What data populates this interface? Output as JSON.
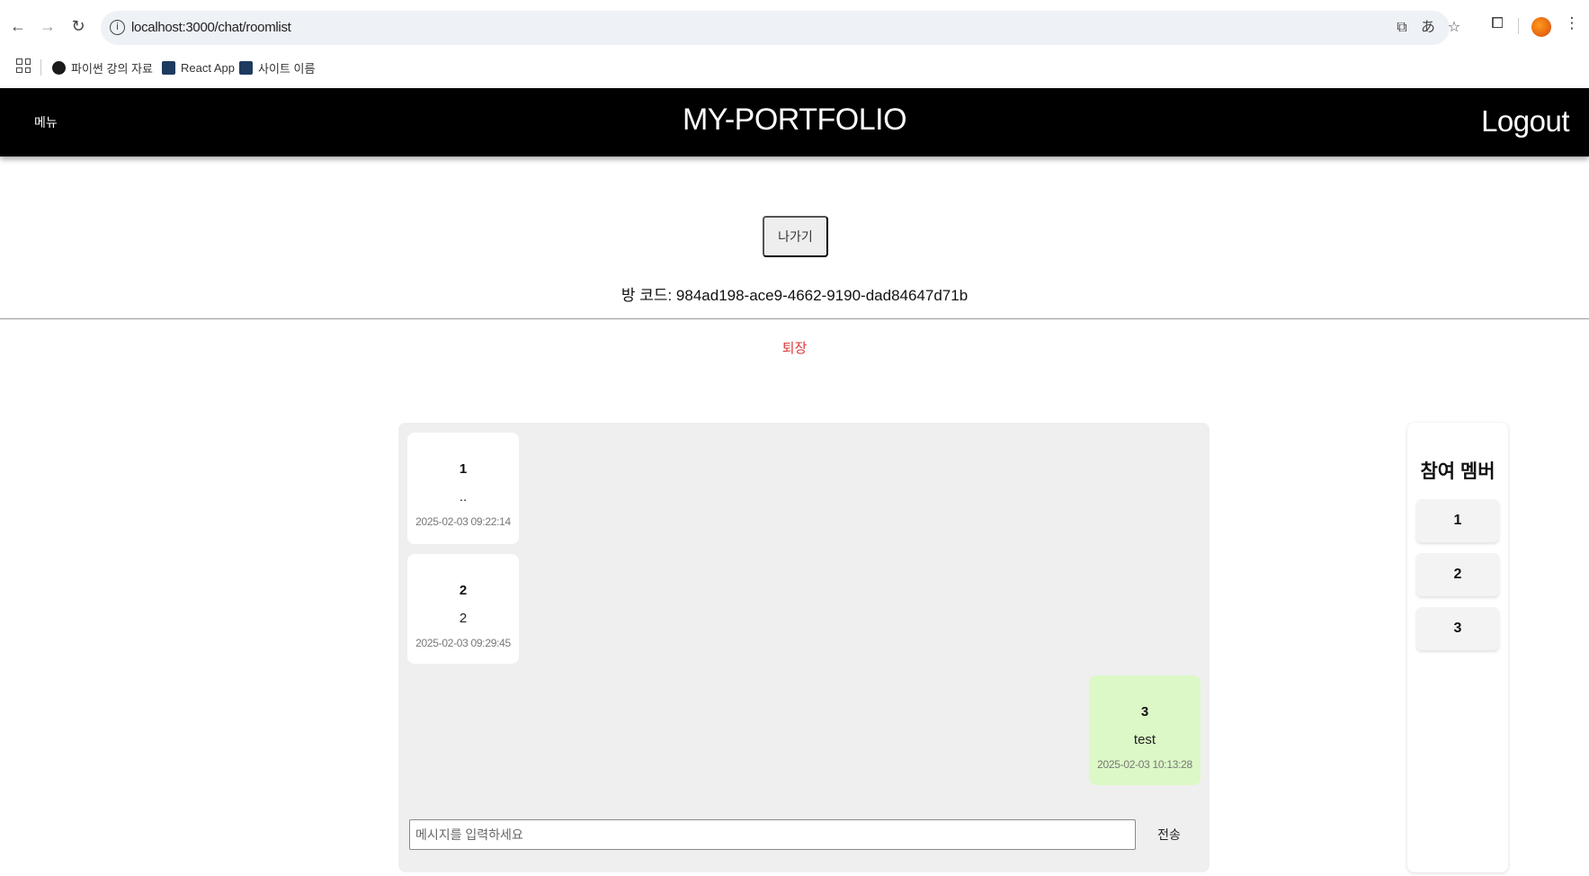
{
  "browser": {
    "url": "localhost:3000/chat/roomlist",
    "bookmarks": [
      {
        "label": "파이썬 강의 자료",
        "icon": "github-icon"
      },
      {
        "label": "React App",
        "icon": "react-icon"
      },
      {
        "label": "사이트 이름",
        "icon": "react-icon"
      }
    ]
  },
  "header": {
    "menu_label": "메뉴",
    "brand": "MY-PORTFOLIO",
    "logout_label": "Logout"
  },
  "room": {
    "exit_button_label": "나가기",
    "room_code_text": "방 코드: 984ad198-ace9-4662-9190-dad84647d71b",
    "leave_link_label": "퇴장"
  },
  "chat": {
    "messages": [
      {
        "sender": "1",
        "content": "..",
        "time": "2025-02-03 09:22:14",
        "mine": false
      },
      {
        "sender": "2",
        "content": "2",
        "time": "2025-02-03 09:29:45",
        "mine": false
      },
      {
        "sender": "3",
        "content": "test",
        "time": "2025-02-03 10:13:28",
        "mine": true
      }
    ],
    "input_placeholder": "메시지를 입력하세요",
    "input_value": "",
    "send_label": "전송"
  },
  "members": {
    "title": "참여 멤버",
    "list": [
      "1",
      "2",
      "3"
    ]
  },
  "colors": {
    "header_bg": "#000000",
    "mine_bubble": "#dcf8c6",
    "other_bubble": "#ffffff",
    "leave_link": "#d93838",
    "chat_bg": "#efefef"
  }
}
